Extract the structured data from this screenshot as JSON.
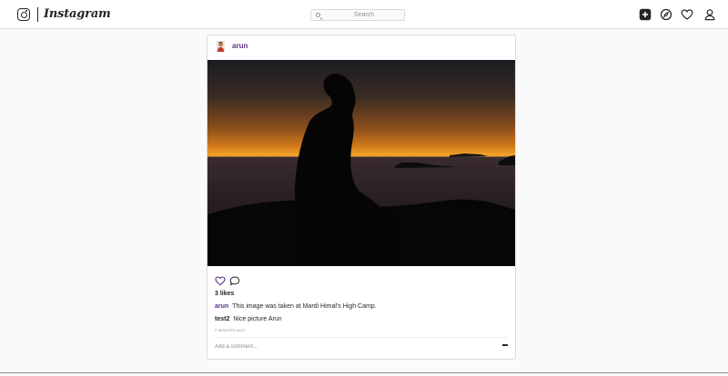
{
  "header": {
    "brand_name": "Instagram",
    "search_placeholder": "Search",
    "icons": [
      "instagram-logo-icon",
      "add-post-icon",
      "explore-icon",
      "heart-icon",
      "profile-icon"
    ]
  },
  "post": {
    "username": "arun",
    "image_alt": "",
    "likes_text": "3 likes",
    "caption": {
      "user": "arun",
      "text": "This image was taken at Mardi Himal's High Camp."
    },
    "comments": [
      {
        "user": "test2",
        "text": "Nice picture Arun"
      }
    ],
    "timestamp": "2 minutes ago",
    "comment_placeholder": "Add a comment...",
    "post_button_icon": "minus-icon"
  },
  "colors": {
    "accent": "#5b2d8e",
    "text": "#262626",
    "muted": "#8e8e8e",
    "border": "#dbdbdb",
    "background": "#fafafa"
  }
}
